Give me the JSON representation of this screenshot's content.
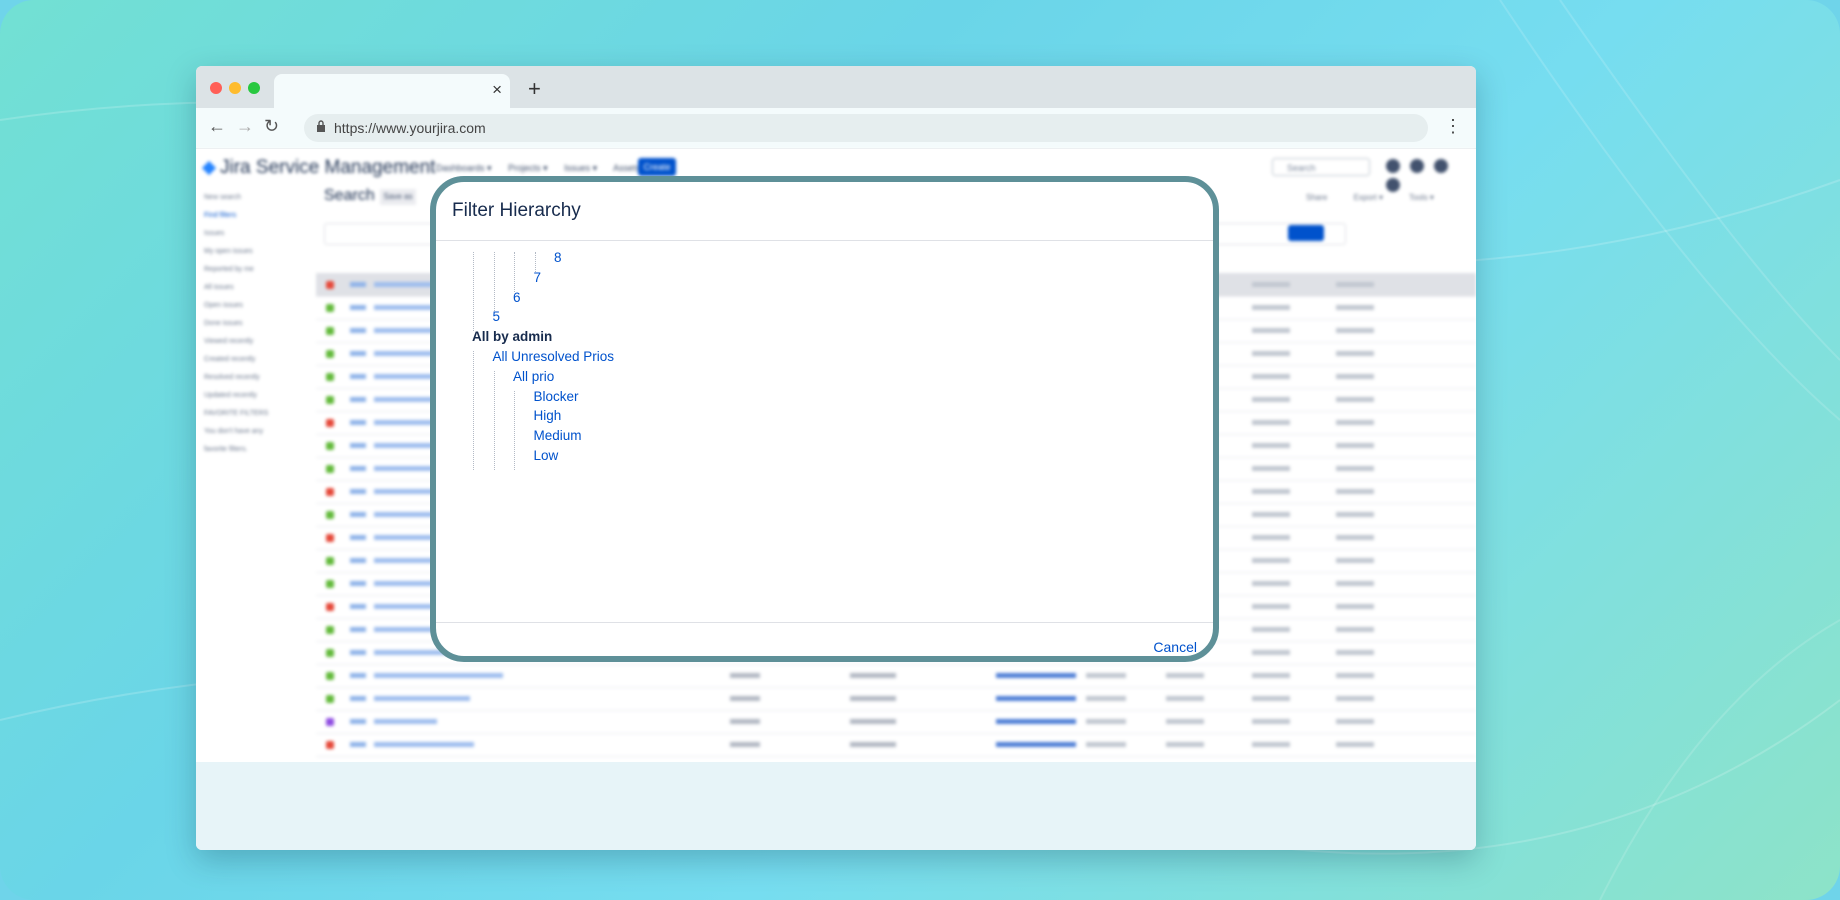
{
  "browser": {
    "url": "https://www.yourjira.com",
    "tab_close": "×",
    "new_tab": "+",
    "back": "←",
    "forward": "→",
    "reload": "↻",
    "menu": "⋮"
  },
  "jira": {
    "logo": "Jira Service Management",
    "nav": [
      "Dashboards ▾",
      "Projects ▾",
      "Issues ▾",
      "Assets ▾"
    ],
    "create": "Create",
    "search_placeholder": "Search",
    "page_title": "Search",
    "save_as": "Save as",
    "sidebar": [
      "New search",
      "Find filters",
      "Issues",
      "My open issues",
      "Reported by me",
      "All issues",
      "Open issues",
      "Done issues",
      "Viewed recently",
      "Created recently",
      "Resolved recently",
      "Updated recently",
      "FAVORITE FILTERS",
      "You don't have any",
      "favorite filters."
    ],
    "toolbar": [
      "Share",
      "Export ▾",
      "Tools ▾"
    ]
  },
  "modal": {
    "title": "Filter Hierarchy",
    "cancel": "Cancel",
    "tree": [
      {
        "label": "8",
        "depth": 4,
        "type": "link"
      },
      {
        "label": "7",
        "depth": 3,
        "type": "link"
      },
      {
        "label": "6",
        "depth": 2,
        "type": "link"
      },
      {
        "label": "5",
        "depth": 1,
        "type": "link"
      },
      {
        "label": "All by admin",
        "depth": 0,
        "type": "bold"
      },
      {
        "label": "All Unresolved Prios",
        "depth": 1,
        "type": "link"
      },
      {
        "label": "All prio",
        "depth": 2,
        "type": "link"
      },
      {
        "label": "Blocker",
        "depth": 3,
        "type": "link"
      },
      {
        "label": "High",
        "depth": 3,
        "type": "link"
      },
      {
        "label": "Medium",
        "depth": 3,
        "type": "link"
      },
      {
        "label": "Low",
        "depth": 3,
        "type": "link"
      }
    ]
  },
  "colors": {
    "accent": "#0052cc",
    "modal_border": "#5e9098",
    "bug": "#e5493a",
    "story": "#63ba3c",
    "task": "#904ee2"
  }
}
